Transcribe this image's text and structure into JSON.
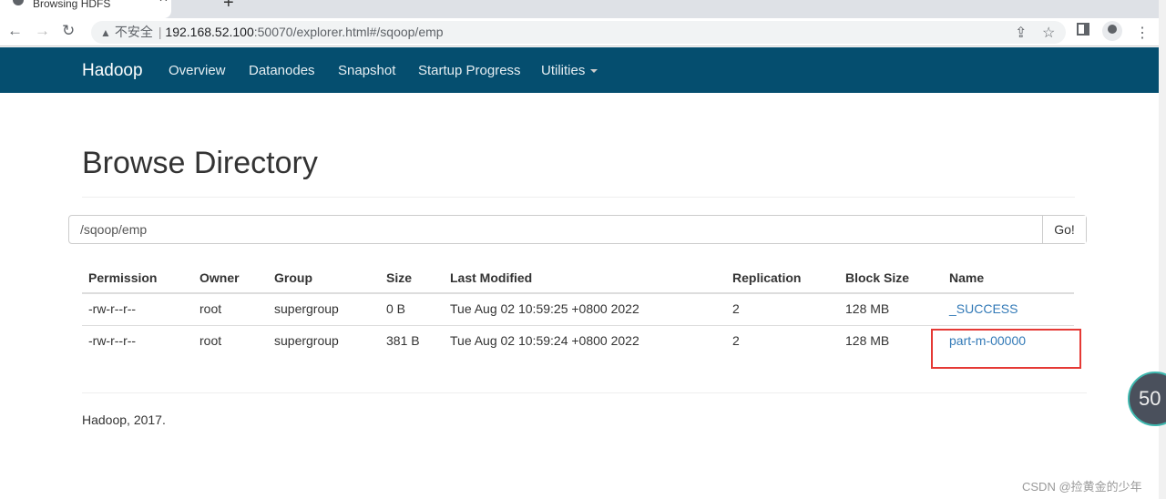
{
  "browser": {
    "tab_title": "Browsing HDFS",
    "url_insecure": "不安全",
    "url_host": "192.168.52.100",
    "url_rest": ":50070/explorer.html#/sqoop/emp",
    "close": "✕",
    "newtab": "+"
  },
  "nav": {
    "brand": "Hadoop",
    "links": [
      "Overview",
      "Datanodes",
      "Snapshot",
      "Startup Progress",
      "Utilities"
    ]
  },
  "page": {
    "title": "Browse Directory",
    "path_value": "/sqoop/emp",
    "go_label": "Go!"
  },
  "table": {
    "headers": [
      "Permission",
      "Owner",
      "Group",
      "Size",
      "Last Modified",
      "Replication",
      "Block Size",
      "Name"
    ],
    "rows": [
      [
        "-rw-r--r--",
        "root",
        "supergroup",
        "0 B",
        "Tue Aug 02 10:59:25 +0800 2022",
        "2",
        "128 MB",
        "_SUCCESS"
      ],
      [
        "-rw-r--r--",
        "root",
        "supergroup",
        "381 B",
        "Tue Aug 02 10:59:24 +0800 2022",
        "2",
        "128 MB",
        "part-m-00000"
      ]
    ]
  },
  "footer": "Hadoop, 2017.",
  "overlay": {
    "badge": "50",
    "watermark": "CSDN @捡黄金的少年"
  }
}
